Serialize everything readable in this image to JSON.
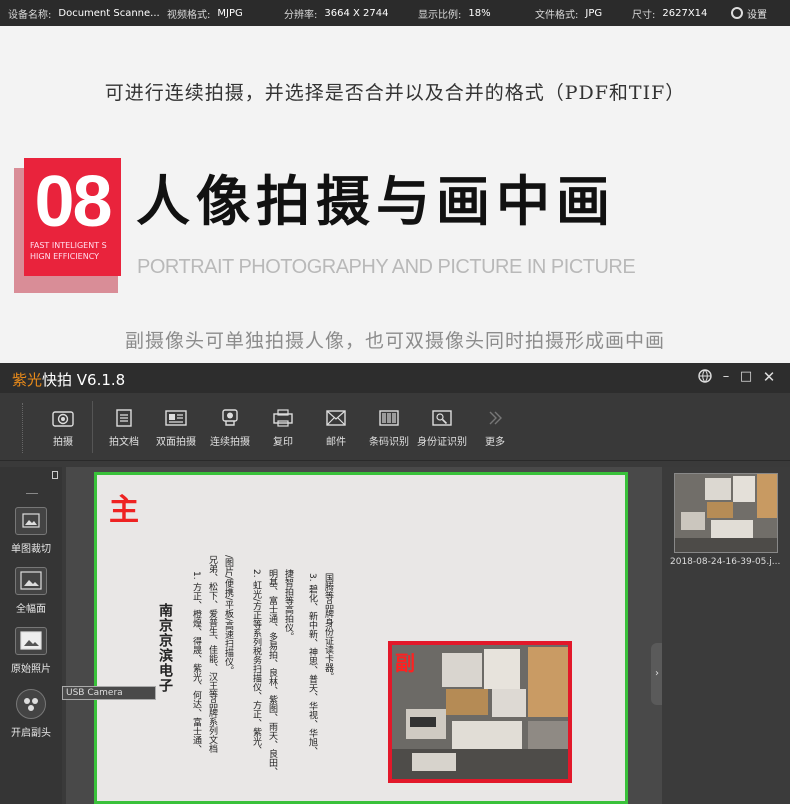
{
  "status_bar": {
    "device_label": "设备名称:",
    "device_value": "Document Scanne...",
    "video_format_label": "视频格式:",
    "video_format_value": "MJPG",
    "resolution_label": "分辨率:",
    "resolution_value": "3664 X 2744",
    "zoom_label": "显示比例:",
    "zoom_value": "18%",
    "file_format_label": "文件格式:",
    "file_format_value": "JPG",
    "size_label": "尺寸:",
    "size_value": "2627X14",
    "settings_label": "设置",
    "settings_icon": "gear-icon"
  },
  "promo": {
    "intro": "可进行连续拍摄，并选择是否合并以及合并的格式（PDF和TIF）",
    "badge_number": "08",
    "badge_subtitle_1": "FAST INTELIGENT S",
    "badge_subtitle_2": "HIGN EFFICIENCY",
    "headline": "人像拍摄与画中画",
    "subheadline": "PORTRAIT PHOTOGRAPHY AND PICTURE IN PICTURE",
    "caption": "副摄像头可单独拍摄人像，也可双摄像头同时拍摄形成画中画",
    "colors": {
      "badge": "#e9233c",
      "headline": "#111111",
      "subheadline": "#b9b9b9"
    }
  },
  "app": {
    "title_brand": "紫光",
    "title_rest": "快拍 V6.1.8",
    "window_controls": {
      "globe_icon": "globe-icon",
      "minimize": "–",
      "maximize": "□",
      "close": "✕"
    },
    "toolbar": {
      "capture": "拍摄",
      "items": [
        {
          "label": "拍文档",
          "icon": "document-icon"
        },
        {
          "label": "双面拍摄",
          "icon": "duplex-icon"
        },
        {
          "label": "连续拍摄",
          "icon": "continuous-camera-icon"
        },
        {
          "label": "复印",
          "icon": "copy-icon"
        },
        {
          "label": "邮件",
          "icon": "mail-icon"
        },
        {
          "label": "条码识别",
          "icon": "barcode-icon"
        },
        {
          "label": "身份证识别",
          "icon": "id-card-icon"
        },
        {
          "label": "更多",
          "icon": "more-icon"
        }
      ]
    },
    "side_tools": [
      {
        "label": "单图裁切",
        "icon": "single-crop-icon"
      },
      {
        "label": "全幅面",
        "icon": "full-frame-icon"
      },
      {
        "label": "原始照片",
        "icon": "original-photo-icon"
      },
      {
        "label": "开启副头",
        "icon": "secondary-camera-icon"
      }
    ],
    "usb_tooltip": "USB Camera",
    "viewer": {
      "main_label": "主",
      "pip_label": "副",
      "doc_title": "南京京滨电子",
      "doc_columns": [
        "1. 方正、橙煌、得晟、紫光、何达、富士通、",
        "兄弟、松下、爱普生、佳能、汉王等品牌系列文档",
        "/图片/便携/平板/高速扫描仪。",
        "2. 虹光/方正等系列税务扫描仪、方正、紫光、",
        "明基、富士通、多易拍、良林、紫图、雨天、良田、",
        "捷智拍等高拍仪。",
        "3. 碧化、新中新、神思、普天、华视、华旭、",
        "国腾等品牌身份证读卡器。"
      ]
    },
    "thumbnail": {
      "caption": "2018-08-24-16-39-05.j..."
    }
  }
}
